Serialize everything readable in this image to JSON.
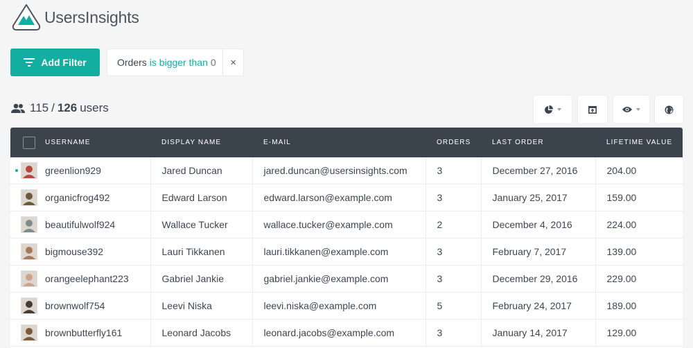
{
  "app": {
    "name": "UsersInsights"
  },
  "filters": {
    "add_label": "Add Filter",
    "chip": {
      "field": "Orders",
      "operator": "is bigger than",
      "value": "0",
      "close": "×"
    }
  },
  "users": {
    "filtered": "115",
    "separator": "/",
    "total": "126",
    "suffix": "users"
  },
  "toolbar": {
    "buttons": [
      {
        "icon": "pie-chart-icon",
        "dropdown": true
      },
      {
        "icon": "export-icon",
        "dropdown": false
      },
      {
        "icon": "eye-icon",
        "dropdown": true
      },
      {
        "icon": "globe-icon",
        "dropdown": false
      }
    ]
  },
  "table": {
    "headers": [
      "USERNAME",
      "DISPLAY NAME",
      "E-MAIL",
      "ORDERS",
      "LAST ORDER",
      "LIFETIME VALUE"
    ],
    "rows": [
      {
        "username": "greenlion929",
        "display": "Jared Duncan",
        "email": "jared.duncan@usersinsights.com",
        "orders": "3",
        "last_order": "December 27, 2016",
        "ltv": "204.00",
        "avatar_color": "#b8463c",
        "online": true
      },
      {
        "username": "organicfrog492",
        "display": "Edward Larson",
        "email": "edward.larson@example.com",
        "orders": "3",
        "last_order": "January 25, 2017",
        "ltv": "159.00",
        "avatar_color": "#6b5a3c",
        "online": false
      },
      {
        "username": "beautifulwolf924",
        "display": "Wallace Tucker",
        "email": "wallace.tucker@example.com",
        "orders": "2",
        "last_order": "December 4, 2016",
        "ltv": "224.00",
        "avatar_color": "#7d8d8a",
        "online": false
      },
      {
        "username": "bigmouse392",
        "display": "Lauri Tikkanen",
        "email": "lauri.tikkanen@example.com",
        "orders": "3",
        "last_order": "February 7, 2017",
        "ltv": "139.00",
        "avatar_color": "#a67a5c",
        "online": false
      },
      {
        "username": "orangeelephant223",
        "display": "Gabriel Jankie",
        "email": "gabriel.jankie@example.com",
        "orders": "3",
        "last_order": "December 29, 2016",
        "ltv": "229.00",
        "avatar_color": "#c9a58a",
        "online": false
      },
      {
        "username": "brownwolf754",
        "display": "Leevi Niska",
        "email": "leevi.niska@example.com",
        "orders": "5",
        "last_order": "February 24, 2017",
        "ltv": "189.00",
        "avatar_color": "#4a3a30",
        "online": false
      },
      {
        "username": "brownbutterfly161",
        "display": "Leonard Jacobs",
        "email": "leonard.jacobs@example.com",
        "orders": "3",
        "last_order": "January 14, 2017",
        "ltv": "129.00",
        "avatar_color": "#7a5a3a",
        "online": false
      }
    ]
  },
  "colors": {
    "accent": "#11aea1",
    "header_bg": "#3b444d",
    "page_bg": "#f5f5f5"
  }
}
